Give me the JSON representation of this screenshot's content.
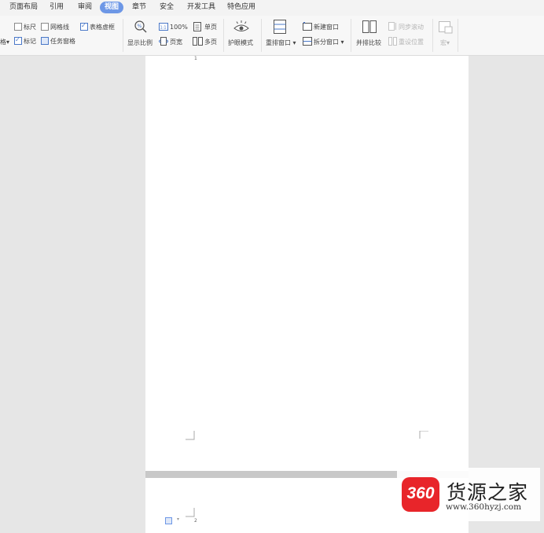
{
  "menu": {
    "tabs": [
      "页面布局",
      "引用",
      "审阅",
      "视图",
      "章节",
      "安全",
      "开发工具",
      "特色应用"
    ]
  },
  "ribbon": {
    "left_cut": "格",
    "show_hide": {
      "ruler": {
        "label": "标尺",
        "checked": false
      },
      "gridlines": {
        "label": "网格线",
        "checked": false
      },
      "table_gridlines": {
        "label": "表格虚框",
        "checked": true
      },
      "marks": {
        "label": "标记",
        "checked": true
      },
      "task_pane": {
        "label": "任务窗格",
        "checked": true
      }
    },
    "zoom": {
      "display_ratio": "显示比例",
      "hundred_percent": "100%",
      "page_width": "页宽",
      "single_page": "单页",
      "multi_page": "多页"
    },
    "eye_protection": "护眼模式",
    "window": {
      "arrange": "重排窗口",
      "new_window": "新建窗口",
      "split": "拆分窗口"
    },
    "compare": {
      "side_by_side": "并排比较",
      "sync_scroll": "同步滚动",
      "reset_position": "重设位置"
    },
    "macro": "宏"
  },
  "document": {
    "page1_number": "1",
    "page2_number": "2"
  },
  "watermark": {
    "logo_number": "360",
    "site_name": "货源之家",
    "url": "www.360hyzj.com"
  },
  "colors": {
    "accent": "#6d97e6",
    "logo_red": "#e8252a",
    "canvas": "#e6e6e6"
  }
}
